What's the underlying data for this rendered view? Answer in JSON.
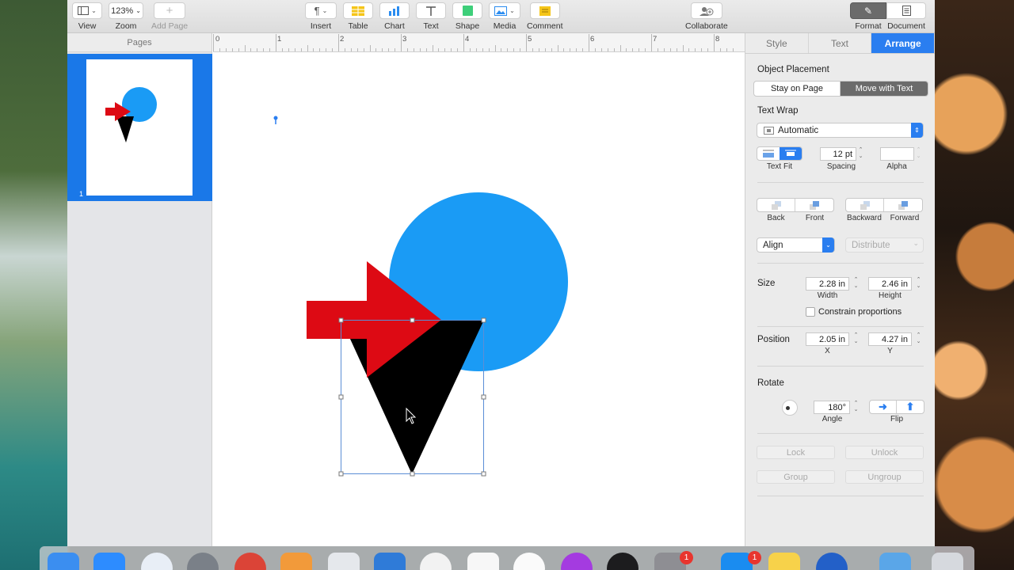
{
  "toolbar": {
    "view_label": "View",
    "zoom_value": "123%",
    "zoom_label": "Zoom",
    "add_page_label": "Add Page",
    "insert_label": "Insert",
    "table_label": "Table",
    "chart_label": "Chart",
    "text_label": "Text",
    "shape_label": "Shape",
    "media_label": "Media",
    "comment_label": "Comment",
    "collaborate_label": "Collaborate",
    "format_label": "Format",
    "document_label": "Document"
  },
  "sidebar": {
    "title": "Pages",
    "pages": [
      {
        "number": "1"
      }
    ]
  },
  "ruler": {
    "labels": [
      "0",
      "1",
      "2",
      "3",
      "4",
      "5",
      "6",
      "7",
      "8"
    ]
  },
  "inspector": {
    "tabs": [
      "Style",
      "Text",
      "Arrange"
    ],
    "active_tab": "Arrange",
    "object_placement": {
      "title": "Object Placement",
      "options": [
        "Stay on Page",
        "Move with Text"
      ],
      "selected": "Move with Text"
    },
    "text_wrap": {
      "title": "Text Wrap",
      "value": "Automatic",
      "text_fit_label": "Text Fit",
      "spacing_value": "12 pt",
      "spacing_label": "Spacing",
      "alpha_value": "",
      "alpha_label": "Alpha"
    },
    "arrange_buttons": [
      "Back",
      "Front",
      "Backward",
      "Forward"
    ],
    "align_label": "Align",
    "distribute_label": "Distribute",
    "size": {
      "title": "Size",
      "width": "2.28 in",
      "width_label": "Width",
      "height": "2.46 in",
      "height_label": "Height",
      "constrain_label": "Constrain proportions"
    },
    "position": {
      "title": "Position",
      "x": "2.05 in",
      "x_label": "X",
      "y": "4.27 in",
      "y_label": "Y"
    },
    "rotate": {
      "title": "Rotate",
      "angle": "180°",
      "angle_label": "Angle",
      "flip_label": "Flip"
    },
    "lock_label": "Lock",
    "unlock_label": "Unlock",
    "group_label": "Group",
    "ungroup_label": "Ungroup"
  },
  "shapes": {
    "circle_color": "#1a9bf5",
    "arrow_color": "#dd0a14",
    "triangle_color": "#000000"
  },
  "dock": {
    "badges": [
      "1",
      "1"
    ]
  }
}
